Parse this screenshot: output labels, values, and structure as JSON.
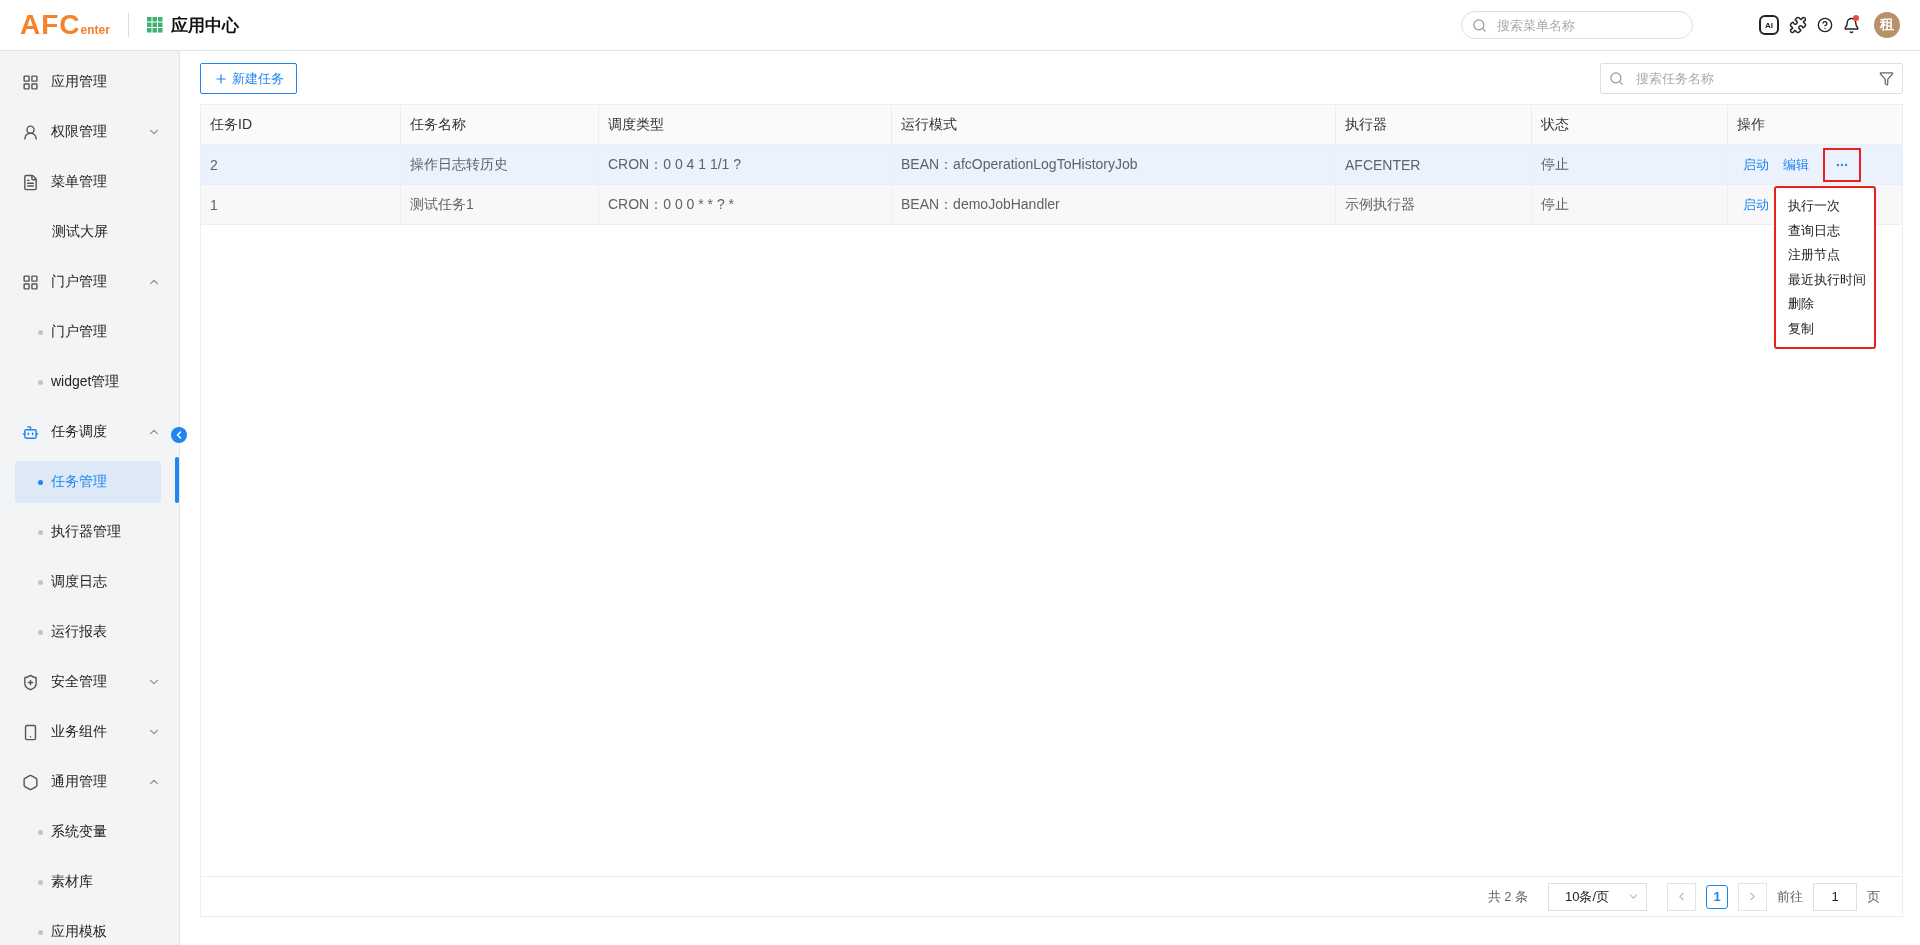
{
  "header": {
    "logo": {
      "main": "AFC",
      "sub": "enter"
    },
    "title": "应用中心",
    "search": {
      "placeholder": "搜索菜单名称"
    },
    "ai_label": "AI",
    "notification": true,
    "avatar": "租"
  },
  "sidebar": {
    "items": [
      {
        "kind": "module",
        "label": "应用管理",
        "active": false
      },
      {
        "kind": "module",
        "label": "权限管理",
        "active": false,
        "expanded": false
      },
      {
        "kind": "module",
        "label": "菜单管理",
        "active": false
      },
      {
        "kind": "page",
        "label": "测试大屏"
      },
      {
        "kind": "module",
        "label": "门户管理",
        "active": false,
        "expanded": true,
        "children": [
          {
            "label": "门户管理",
            "selected": false
          },
          {
            "label": "widget管理",
            "selected": false
          }
        ]
      },
      {
        "kind": "module",
        "label": "任务调度",
        "active": true,
        "expanded": true,
        "children": [
          {
            "label": "任务管理",
            "selected": true
          },
          {
            "label": "执行器管理",
            "selected": false
          },
          {
            "label": "调度日志",
            "selected": false
          },
          {
            "label": "运行报表",
            "selected": false
          }
        ]
      },
      {
        "kind": "module",
        "label": "安全管理",
        "active": false,
        "expanded": false
      },
      {
        "kind": "module",
        "label": "业务组件",
        "active": false,
        "expanded": false
      },
      {
        "kind": "module",
        "label": "通用管理",
        "active": false,
        "expanded": true,
        "children": [
          {
            "label": "系统变量",
            "selected": false
          },
          {
            "label": "素材库",
            "selected": false
          },
          {
            "label": "应用模板",
            "selected": false
          }
        ]
      }
    ]
  },
  "toolbar": {
    "new_button": "新建任务",
    "search": {
      "placeholder": "搜索任务名称"
    }
  },
  "table": {
    "columns": [
      "任务ID",
      "任务名称",
      "调度类型",
      "运行模式",
      "执行器",
      "状态",
      "操作"
    ],
    "rows": [
      {
        "selected": true,
        "cells": [
          "2",
          "操作日志转历史",
          "CRON：0 0 4 1 1/1 ?",
          "BEAN：afcOperationLogToHistoryJob",
          "AFCENTER",
          "停止"
        ],
        "actions": [
          "启动",
          "编辑"
        ],
        "more": true
      },
      {
        "selected": false,
        "cells": [
          "1",
          "测试任务1",
          "CRON：0 0 0 * * ? *",
          "BEAN：demoJobHandler",
          "示例执行器",
          "停止"
        ],
        "actions": [
          "启动"
        ]
      }
    ]
  },
  "row_menu": {
    "items": [
      "执行一次",
      "查询日志",
      "注册节点",
      "最近执行时间",
      "删除",
      "复制"
    ]
  },
  "pagination": {
    "total": "共 2 条",
    "page_size": "10条/页",
    "pages": [
      {
        "label": "1",
        "selected": true
      }
    ],
    "goto_label": "前往",
    "goto_value": "1",
    "page_suffix": "页"
  }
}
